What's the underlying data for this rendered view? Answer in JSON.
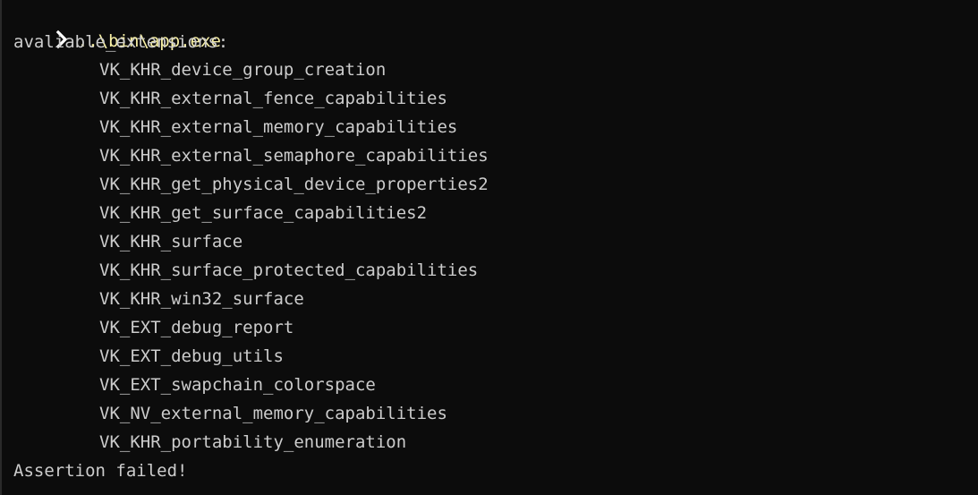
{
  "prompt": {
    "icon": "chevron-right-icon",
    "command": "..\\bin\\app.exe"
  },
  "output": {
    "header": "avaliable_extensions:",
    "extensions": [
      "VK_KHR_device_group_creation",
      "VK_KHR_external_fence_capabilities",
      "VK_KHR_external_memory_capabilities",
      "VK_KHR_external_semaphore_capabilities",
      "VK_KHR_get_physical_device_properties2",
      "VK_KHR_get_surface_capabilities2",
      "VK_KHR_surface",
      "VK_KHR_surface_protected_capabilities",
      "VK_KHR_win32_surface",
      "VK_EXT_debug_report",
      "VK_EXT_debug_utils",
      "VK_EXT_swapchain_colorspace",
      "VK_NV_external_memory_capabilities",
      "VK_KHR_portability_enumeration"
    ],
    "footer": "Assertion failed!"
  },
  "colors": {
    "background": "#0c0c0c",
    "text": "#cccccc",
    "command": "#f9f1a5"
  }
}
